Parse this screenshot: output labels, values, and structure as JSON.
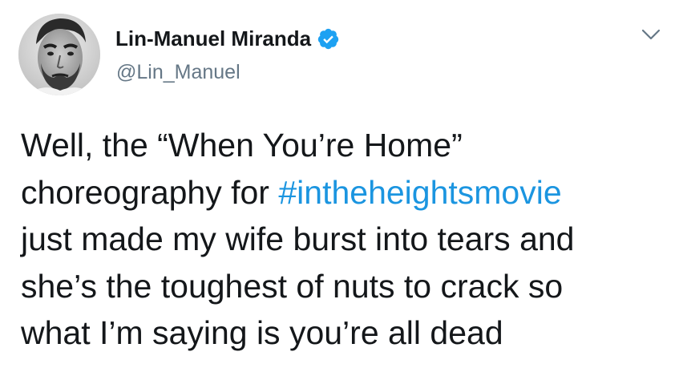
{
  "user": {
    "display_name": "Lin-Manuel Miranda",
    "handle": "@Lin_Manuel",
    "verified": true,
    "verified_icon": "verified-badge-icon",
    "avatar": "profile-photo"
  },
  "menu": {
    "icon": "chevron-down-icon"
  },
  "tweet": {
    "line1": "Well, the “When You’re Home”",
    "line2_prefix": "choreography for ",
    "hashtag": "#intheheightsmovie",
    "line3": "just made my wife burst into tears and",
    "line4": "she’s the toughest of nuts to crack so",
    "line5": "what I’m saying is you’re all dead"
  },
  "colors": {
    "text": "#14171a",
    "secondary": "#657786",
    "link": "#1b95e0",
    "verified": "#1da1f2"
  }
}
